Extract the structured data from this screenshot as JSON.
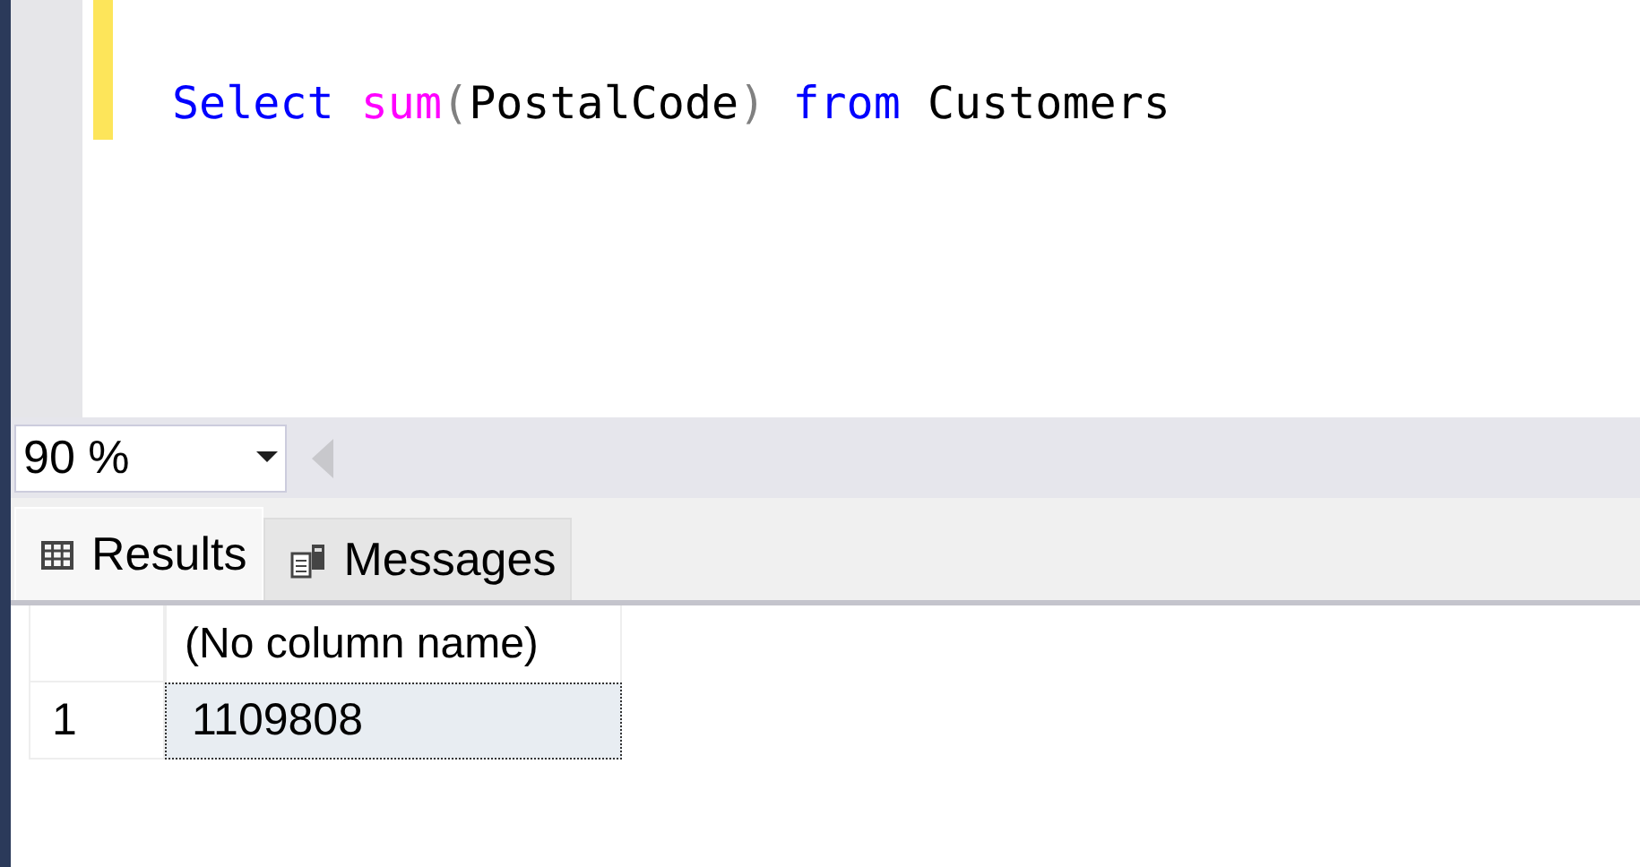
{
  "editor": {
    "lines": [
      {
        "changed": true,
        "tokens": [
          {
            "text": "Select ",
            "kind": "keyword"
          },
          {
            "text": "sum",
            "kind": "function"
          },
          {
            "text": "(",
            "kind": "punct"
          },
          {
            "text": "PostalCode",
            "kind": "plain"
          },
          {
            "text": ")",
            "kind": "punct"
          },
          {
            "text": " from",
            "kind": "keyword"
          },
          {
            "text": " Customers",
            "kind": "plain"
          }
        ]
      }
    ]
  },
  "zoom": {
    "value": "90 %"
  },
  "tabs": [
    {
      "label": "Results",
      "kind": "results",
      "selected": true
    },
    {
      "label": "Messages",
      "kind": "messages",
      "selected": false
    }
  ],
  "grid": {
    "columns": [
      "(No column name)"
    ],
    "rows": [
      {
        "number": "1",
        "cells": [
          {
            "text": "1109808",
            "selected": true
          }
        ]
      }
    ]
  }
}
